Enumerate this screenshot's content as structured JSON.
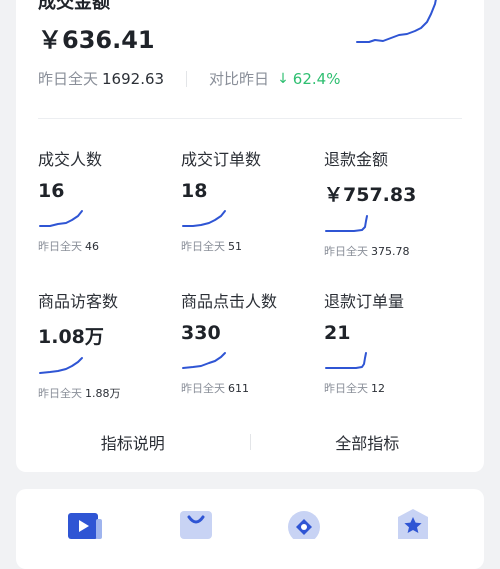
{
  "summary": {
    "title": "成交金额",
    "value": "￥636.41",
    "yesterday_label": "昨日全天",
    "yesterday_value": "1692.63",
    "compare_label": "对比昨日",
    "change_arrow": "↓",
    "change_value": "62.4%"
  },
  "metrics": [
    {
      "label": "成交人数",
      "value": "16",
      "foot_label": "昨日全天",
      "foot_value": "46"
    },
    {
      "label": "成交订单数",
      "value": "18",
      "foot_label": "昨日全天",
      "foot_value": "51"
    },
    {
      "label": "退款金额",
      "value": "￥757.83",
      "foot_label": "昨日全天",
      "foot_value": "375.78"
    },
    {
      "label": "商品访客数",
      "value": "1.08万",
      "foot_label": "昨日全天",
      "foot_value": "1.88万"
    },
    {
      "label": "商品点击人数",
      "value": "330",
      "foot_label": "昨日全天",
      "foot_value": "611"
    },
    {
      "label": "退款订单量",
      "value": "21",
      "foot_label": "昨日全天",
      "foot_value": "12"
    }
  ],
  "links": {
    "indicator_desc": "指标说明",
    "all_indicators": "全部指标"
  },
  "colors": {
    "accent": "#2f55d4",
    "positive": "#2fbf71",
    "muted": "#8a8f99"
  },
  "icons": [
    "video-icon",
    "shopping-bag-icon",
    "location-pin-icon",
    "star-badge-icon"
  ]
}
